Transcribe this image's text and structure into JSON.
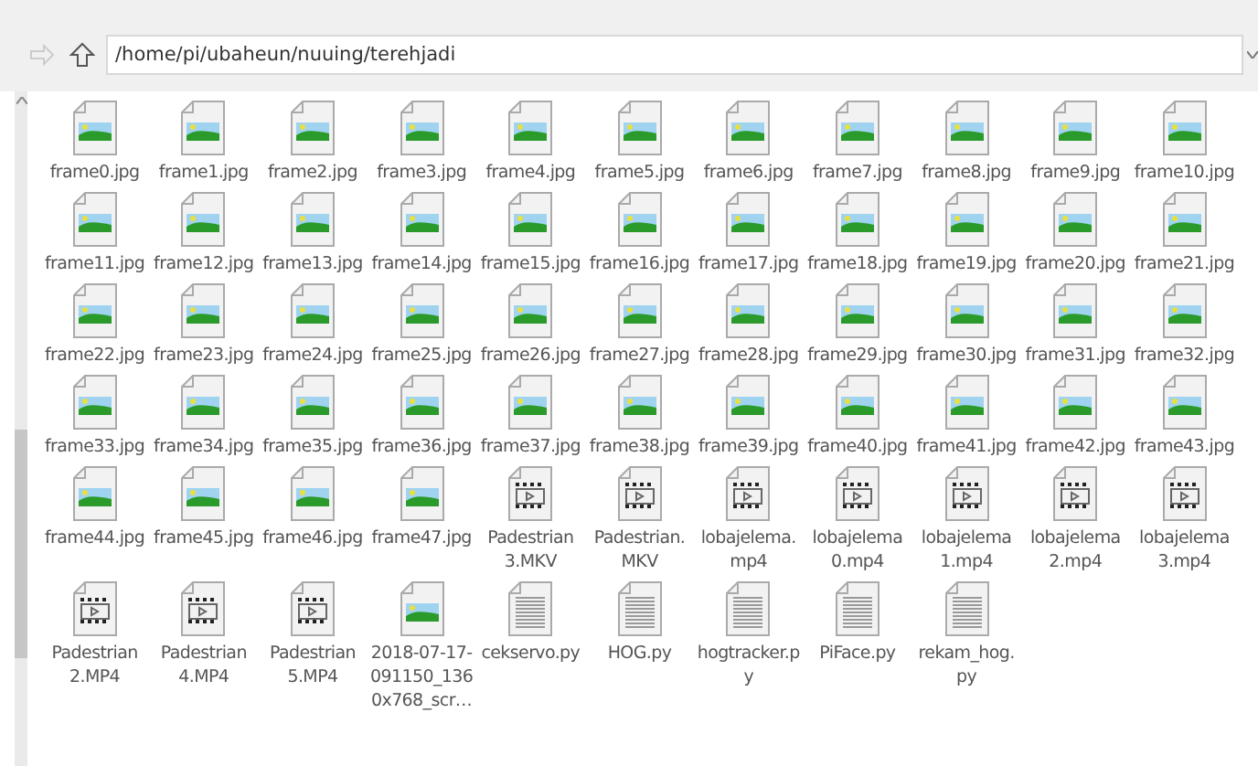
{
  "toolbar": {
    "back_disabled": true,
    "path": "/home/pi/ubaheun/nuuing/terehjadi"
  },
  "files": [
    {
      "kind": "image",
      "label": "frame0.jpg"
    },
    {
      "kind": "image",
      "label": "frame1.jpg"
    },
    {
      "kind": "image",
      "label": "frame2.jpg"
    },
    {
      "kind": "image",
      "label": "frame3.jpg"
    },
    {
      "kind": "image",
      "label": "frame4.jpg"
    },
    {
      "kind": "image",
      "label": "frame5.jpg"
    },
    {
      "kind": "image",
      "label": "frame6.jpg"
    },
    {
      "kind": "image",
      "label": "frame7.jpg"
    },
    {
      "kind": "image",
      "label": "frame8.jpg"
    },
    {
      "kind": "image",
      "label": "frame9.jpg"
    },
    {
      "kind": "image",
      "label": "frame10.jpg"
    },
    {
      "kind": "image",
      "label": "frame11.jpg"
    },
    {
      "kind": "image",
      "label": "frame12.jpg"
    },
    {
      "kind": "image",
      "label": "frame13.jpg"
    },
    {
      "kind": "image",
      "label": "frame14.jpg"
    },
    {
      "kind": "image",
      "label": "frame15.jpg"
    },
    {
      "kind": "image",
      "label": "frame16.jpg"
    },
    {
      "kind": "image",
      "label": "frame17.jpg"
    },
    {
      "kind": "image",
      "label": "frame18.jpg"
    },
    {
      "kind": "image",
      "label": "frame19.jpg"
    },
    {
      "kind": "image",
      "label": "frame20.jpg"
    },
    {
      "kind": "image",
      "label": "frame21.jpg"
    },
    {
      "kind": "image",
      "label": "frame22.jpg"
    },
    {
      "kind": "image",
      "label": "frame23.jpg"
    },
    {
      "kind": "image",
      "label": "frame24.jpg"
    },
    {
      "kind": "image",
      "label": "frame25.jpg"
    },
    {
      "kind": "image",
      "label": "frame26.jpg"
    },
    {
      "kind": "image",
      "label": "frame27.jpg"
    },
    {
      "kind": "image",
      "label": "frame28.jpg"
    },
    {
      "kind": "image",
      "label": "frame29.jpg"
    },
    {
      "kind": "image",
      "label": "frame30.jpg"
    },
    {
      "kind": "image",
      "label": "frame31.jpg"
    },
    {
      "kind": "image",
      "label": "frame32.jpg"
    },
    {
      "kind": "image",
      "label": "frame33.jpg"
    },
    {
      "kind": "image",
      "label": "frame34.jpg"
    },
    {
      "kind": "image",
      "label": "frame35.jpg"
    },
    {
      "kind": "image",
      "label": "frame36.jpg"
    },
    {
      "kind": "image",
      "label": "frame37.jpg"
    },
    {
      "kind": "image",
      "label": "frame38.jpg"
    },
    {
      "kind": "image",
      "label": "frame39.jpg"
    },
    {
      "kind": "image",
      "label": "frame40.jpg"
    },
    {
      "kind": "image",
      "label": "frame41.jpg"
    },
    {
      "kind": "image",
      "label": "frame42.jpg"
    },
    {
      "kind": "image",
      "label": "frame43.jpg"
    },
    {
      "kind": "image",
      "label": "frame44.jpg"
    },
    {
      "kind": "image",
      "label": "frame45.jpg"
    },
    {
      "kind": "image",
      "label": "frame46.jpg"
    },
    {
      "kind": "image",
      "label": "frame47.jpg"
    },
    {
      "kind": "video",
      "label": "Padestrian\n3.MKV"
    },
    {
      "kind": "video",
      "label": "Padestrian.\nMKV"
    },
    {
      "kind": "video",
      "label": "lobajelema.\nmp4"
    },
    {
      "kind": "video",
      "label": "lobajelema\n0.mp4"
    },
    {
      "kind": "video",
      "label": "lobajelema\n1.mp4"
    },
    {
      "kind": "video",
      "label": "lobajelema\n2.mp4"
    },
    {
      "kind": "video",
      "label": "lobajelema\n3.mp4"
    },
    {
      "kind": "video",
      "label": "Padestrian\n2.MP4"
    },
    {
      "kind": "video",
      "label": "Padestrian\n4.MP4"
    },
    {
      "kind": "video",
      "label": "Padestrian\n5.MP4"
    },
    {
      "kind": "image",
      "label": "2018-07-17-\n091150_136\n0x768_scr…"
    },
    {
      "kind": "text",
      "label": "cekservo.py"
    },
    {
      "kind": "text",
      "label": "HOG.py"
    },
    {
      "kind": "text",
      "label": "hogtracker.p\ny"
    },
    {
      "kind": "text",
      "label": "PiFace.py"
    },
    {
      "kind": "text",
      "label": "rekam_hog.\npy"
    }
  ]
}
